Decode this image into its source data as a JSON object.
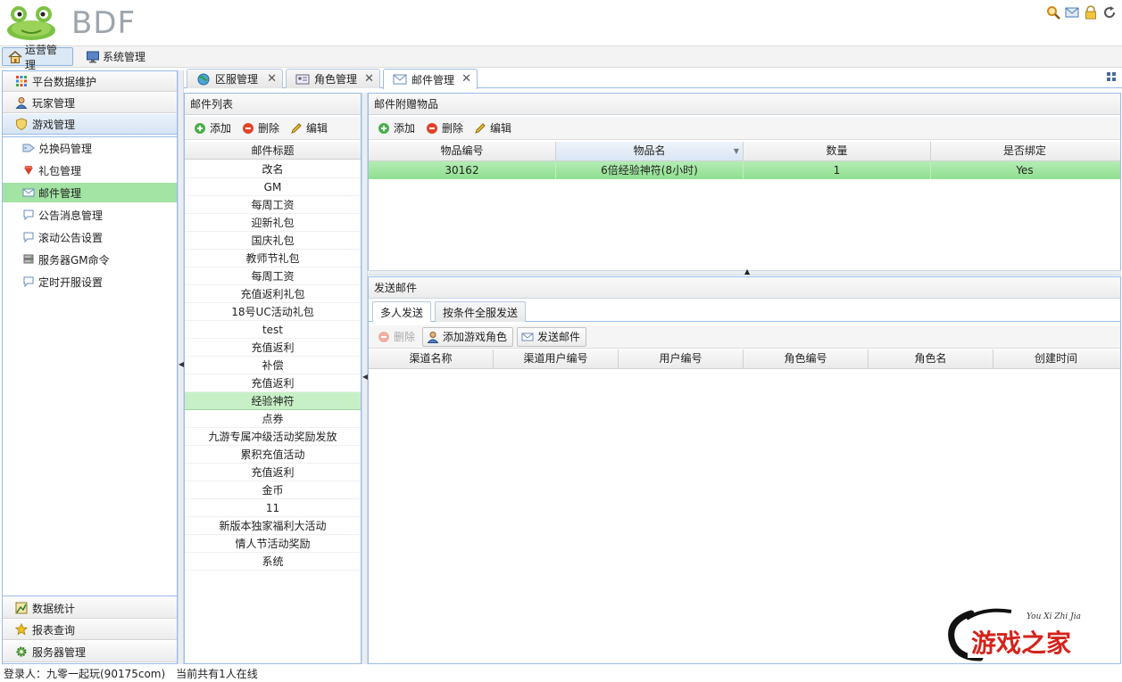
{
  "app": {
    "brand": "BDF"
  },
  "topmenu": [
    {
      "label": "运营管理",
      "icon": "home-icon",
      "active": true
    },
    {
      "label": "系统管理",
      "icon": "monitor-icon",
      "active": false
    }
  ],
  "leftnav": {
    "sections_top": [
      {
        "label": "平台数据维护",
        "icon": "grid-icon"
      },
      {
        "label": "玩家管理",
        "icon": "user-icon"
      },
      {
        "label": "游戏管理",
        "icon": "shield-icon",
        "selected": true
      }
    ],
    "game_items": [
      {
        "label": "兑换码管理",
        "icon": "tag-icon"
      },
      {
        "label": "礼包管理",
        "icon": "gift-icon"
      },
      {
        "label": "邮件管理",
        "icon": "mail-icon",
        "selected": true
      },
      {
        "label": "公告消息管理",
        "icon": "chat-icon"
      },
      {
        "label": "滚动公告设置",
        "icon": "chat-icon"
      },
      {
        "label": "服务器GM命令",
        "icon": "server-icon"
      },
      {
        "label": "定时开服设置",
        "icon": "chat-icon"
      }
    ],
    "sections_bottom": [
      {
        "label": "数据统计",
        "icon": "chart-icon"
      },
      {
        "label": "报表查询",
        "icon": "star-icon"
      },
      {
        "label": "服务器管理",
        "icon": "gear-icon"
      }
    ]
  },
  "tabs": [
    {
      "label": "区服管理",
      "icon": "globe-icon"
    },
    {
      "label": "角色管理",
      "icon": "card-icon"
    },
    {
      "label": "邮件管理",
      "icon": "mail-icon",
      "active": true
    }
  ],
  "mail_list": {
    "title": "邮件列表",
    "toolbar": {
      "add": "添加",
      "delete": "删除",
      "edit": "编辑"
    },
    "column": "邮件标题",
    "rows": [
      "改名",
      "GM",
      "每周工资",
      "迎新礼包",
      "国庆礼包",
      "教师节礼包",
      "每周工资",
      "充值返利礼包",
      "18号UC活动礼包",
      "test",
      "充值返利",
      "补偿",
      "充值返利",
      "经验神符",
      "点券",
      "九游专属冲级活动奖励发放",
      "累积充值活动",
      "充值返利",
      "金币",
      "11",
      "新版本独家福利大活动",
      "情人节活动奖励",
      "系统"
    ],
    "selected_index": 13
  },
  "attachments": {
    "title": "邮件附赠物品",
    "toolbar": {
      "add": "添加",
      "delete": "删除",
      "edit": "编辑"
    },
    "columns": [
      "物品编号",
      "物品名",
      "数量",
      "是否绑定"
    ],
    "rows": [
      [
        "30162",
        "6倍经验神符(8小时)",
        "1",
        "Yes"
      ]
    ]
  },
  "send_mail": {
    "title": "发送邮件",
    "subtabs": [
      {
        "label": "多人发送",
        "active": true
      },
      {
        "label": "按条件全服发送",
        "active": false
      }
    ],
    "toolbar": {
      "delete": "删除",
      "add_role": "添加游戏角色",
      "send": "发送邮件"
    },
    "columns": [
      "渠道名称",
      "渠道用户编号",
      "用户编号",
      "角色编号",
      "角色名",
      "创建时间"
    ]
  },
  "status": {
    "login": "登录人：九零一起玩(90175com)",
    "online": "当前共有1人在线"
  },
  "watermark": {
    "text": "游戏之家",
    "sub": "You Xi Zhi Jia"
  },
  "colors": {
    "selection_green": "#a3e3a3",
    "border_blue": "#99bbe8"
  }
}
